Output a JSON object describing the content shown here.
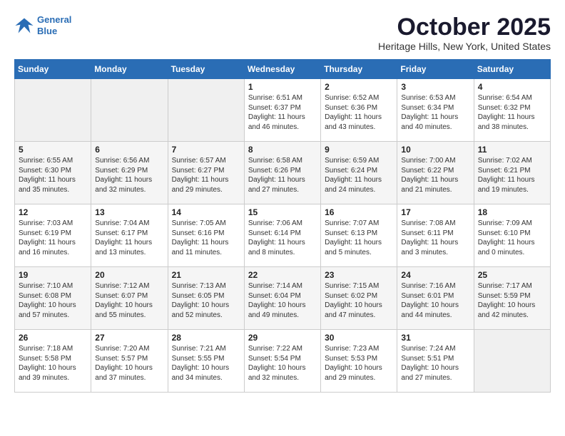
{
  "logo": {
    "line1": "General",
    "line2": "Blue"
  },
  "title": "October 2025",
  "location": "Heritage Hills, New York, United States",
  "weekdays": [
    "Sunday",
    "Monday",
    "Tuesday",
    "Wednesday",
    "Thursday",
    "Friday",
    "Saturday"
  ],
  "weeks": [
    [
      {
        "day": "",
        "info": ""
      },
      {
        "day": "",
        "info": ""
      },
      {
        "day": "",
        "info": ""
      },
      {
        "day": "1",
        "info": "Sunrise: 6:51 AM\nSunset: 6:37 PM\nDaylight: 11 hours\nand 46 minutes."
      },
      {
        "day": "2",
        "info": "Sunrise: 6:52 AM\nSunset: 6:36 PM\nDaylight: 11 hours\nand 43 minutes."
      },
      {
        "day": "3",
        "info": "Sunrise: 6:53 AM\nSunset: 6:34 PM\nDaylight: 11 hours\nand 40 minutes."
      },
      {
        "day": "4",
        "info": "Sunrise: 6:54 AM\nSunset: 6:32 PM\nDaylight: 11 hours\nand 38 minutes."
      }
    ],
    [
      {
        "day": "5",
        "info": "Sunrise: 6:55 AM\nSunset: 6:30 PM\nDaylight: 11 hours\nand 35 minutes."
      },
      {
        "day": "6",
        "info": "Sunrise: 6:56 AM\nSunset: 6:29 PM\nDaylight: 11 hours\nand 32 minutes."
      },
      {
        "day": "7",
        "info": "Sunrise: 6:57 AM\nSunset: 6:27 PM\nDaylight: 11 hours\nand 29 minutes."
      },
      {
        "day": "8",
        "info": "Sunrise: 6:58 AM\nSunset: 6:26 PM\nDaylight: 11 hours\nand 27 minutes."
      },
      {
        "day": "9",
        "info": "Sunrise: 6:59 AM\nSunset: 6:24 PM\nDaylight: 11 hours\nand 24 minutes."
      },
      {
        "day": "10",
        "info": "Sunrise: 7:00 AM\nSunset: 6:22 PM\nDaylight: 11 hours\nand 21 minutes."
      },
      {
        "day": "11",
        "info": "Sunrise: 7:02 AM\nSunset: 6:21 PM\nDaylight: 11 hours\nand 19 minutes."
      }
    ],
    [
      {
        "day": "12",
        "info": "Sunrise: 7:03 AM\nSunset: 6:19 PM\nDaylight: 11 hours\nand 16 minutes."
      },
      {
        "day": "13",
        "info": "Sunrise: 7:04 AM\nSunset: 6:17 PM\nDaylight: 11 hours\nand 13 minutes."
      },
      {
        "day": "14",
        "info": "Sunrise: 7:05 AM\nSunset: 6:16 PM\nDaylight: 11 hours\nand 11 minutes."
      },
      {
        "day": "15",
        "info": "Sunrise: 7:06 AM\nSunset: 6:14 PM\nDaylight: 11 hours\nand 8 minutes."
      },
      {
        "day": "16",
        "info": "Sunrise: 7:07 AM\nSunset: 6:13 PM\nDaylight: 11 hours\nand 5 minutes."
      },
      {
        "day": "17",
        "info": "Sunrise: 7:08 AM\nSunset: 6:11 PM\nDaylight: 11 hours\nand 3 minutes."
      },
      {
        "day": "18",
        "info": "Sunrise: 7:09 AM\nSunset: 6:10 PM\nDaylight: 11 hours\nand 0 minutes."
      }
    ],
    [
      {
        "day": "19",
        "info": "Sunrise: 7:10 AM\nSunset: 6:08 PM\nDaylight: 10 hours\nand 57 minutes."
      },
      {
        "day": "20",
        "info": "Sunrise: 7:12 AM\nSunset: 6:07 PM\nDaylight: 10 hours\nand 55 minutes."
      },
      {
        "day": "21",
        "info": "Sunrise: 7:13 AM\nSunset: 6:05 PM\nDaylight: 10 hours\nand 52 minutes."
      },
      {
        "day": "22",
        "info": "Sunrise: 7:14 AM\nSunset: 6:04 PM\nDaylight: 10 hours\nand 49 minutes."
      },
      {
        "day": "23",
        "info": "Sunrise: 7:15 AM\nSunset: 6:02 PM\nDaylight: 10 hours\nand 47 minutes."
      },
      {
        "day": "24",
        "info": "Sunrise: 7:16 AM\nSunset: 6:01 PM\nDaylight: 10 hours\nand 44 minutes."
      },
      {
        "day": "25",
        "info": "Sunrise: 7:17 AM\nSunset: 5:59 PM\nDaylight: 10 hours\nand 42 minutes."
      }
    ],
    [
      {
        "day": "26",
        "info": "Sunrise: 7:18 AM\nSunset: 5:58 PM\nDaylight: 10 hours\nand 39 minutes."
      },
      {
        "day": "27",
        "info": "Sunrise: 7:20 AM\nSunset: 5:57 PM\nDaylight: 10 hours\nand 37 minutes."
      },
      {
        "day": "28",
        "info": "Sunrise: 7:21 AM\nSunset: 5:55 PM\nDaylight: 10 hours\nand 34 minutes."
      },
      {
        "day": "29",
        "info": "Sunrise: 7:22 AM\nSunset: 5:54 PM\nDaylight: 10 hours\nand 32 minutes."
      },
      {
        "day": "30",
        "info": "Sunrise: 7:23 AM\nSunset: 5:53 PM\nDaylight: 10 hours\nand 29 minutes."
      },
      {
        "day": "31",
        "info": "Sunrise: 7:24 AM\nSunset: 5:51 PM\nDaylight: 10 hours\nand 27 minutes."
      },
      {
        "day": "",
        "info": ""
      }
    ]
  ]
}
